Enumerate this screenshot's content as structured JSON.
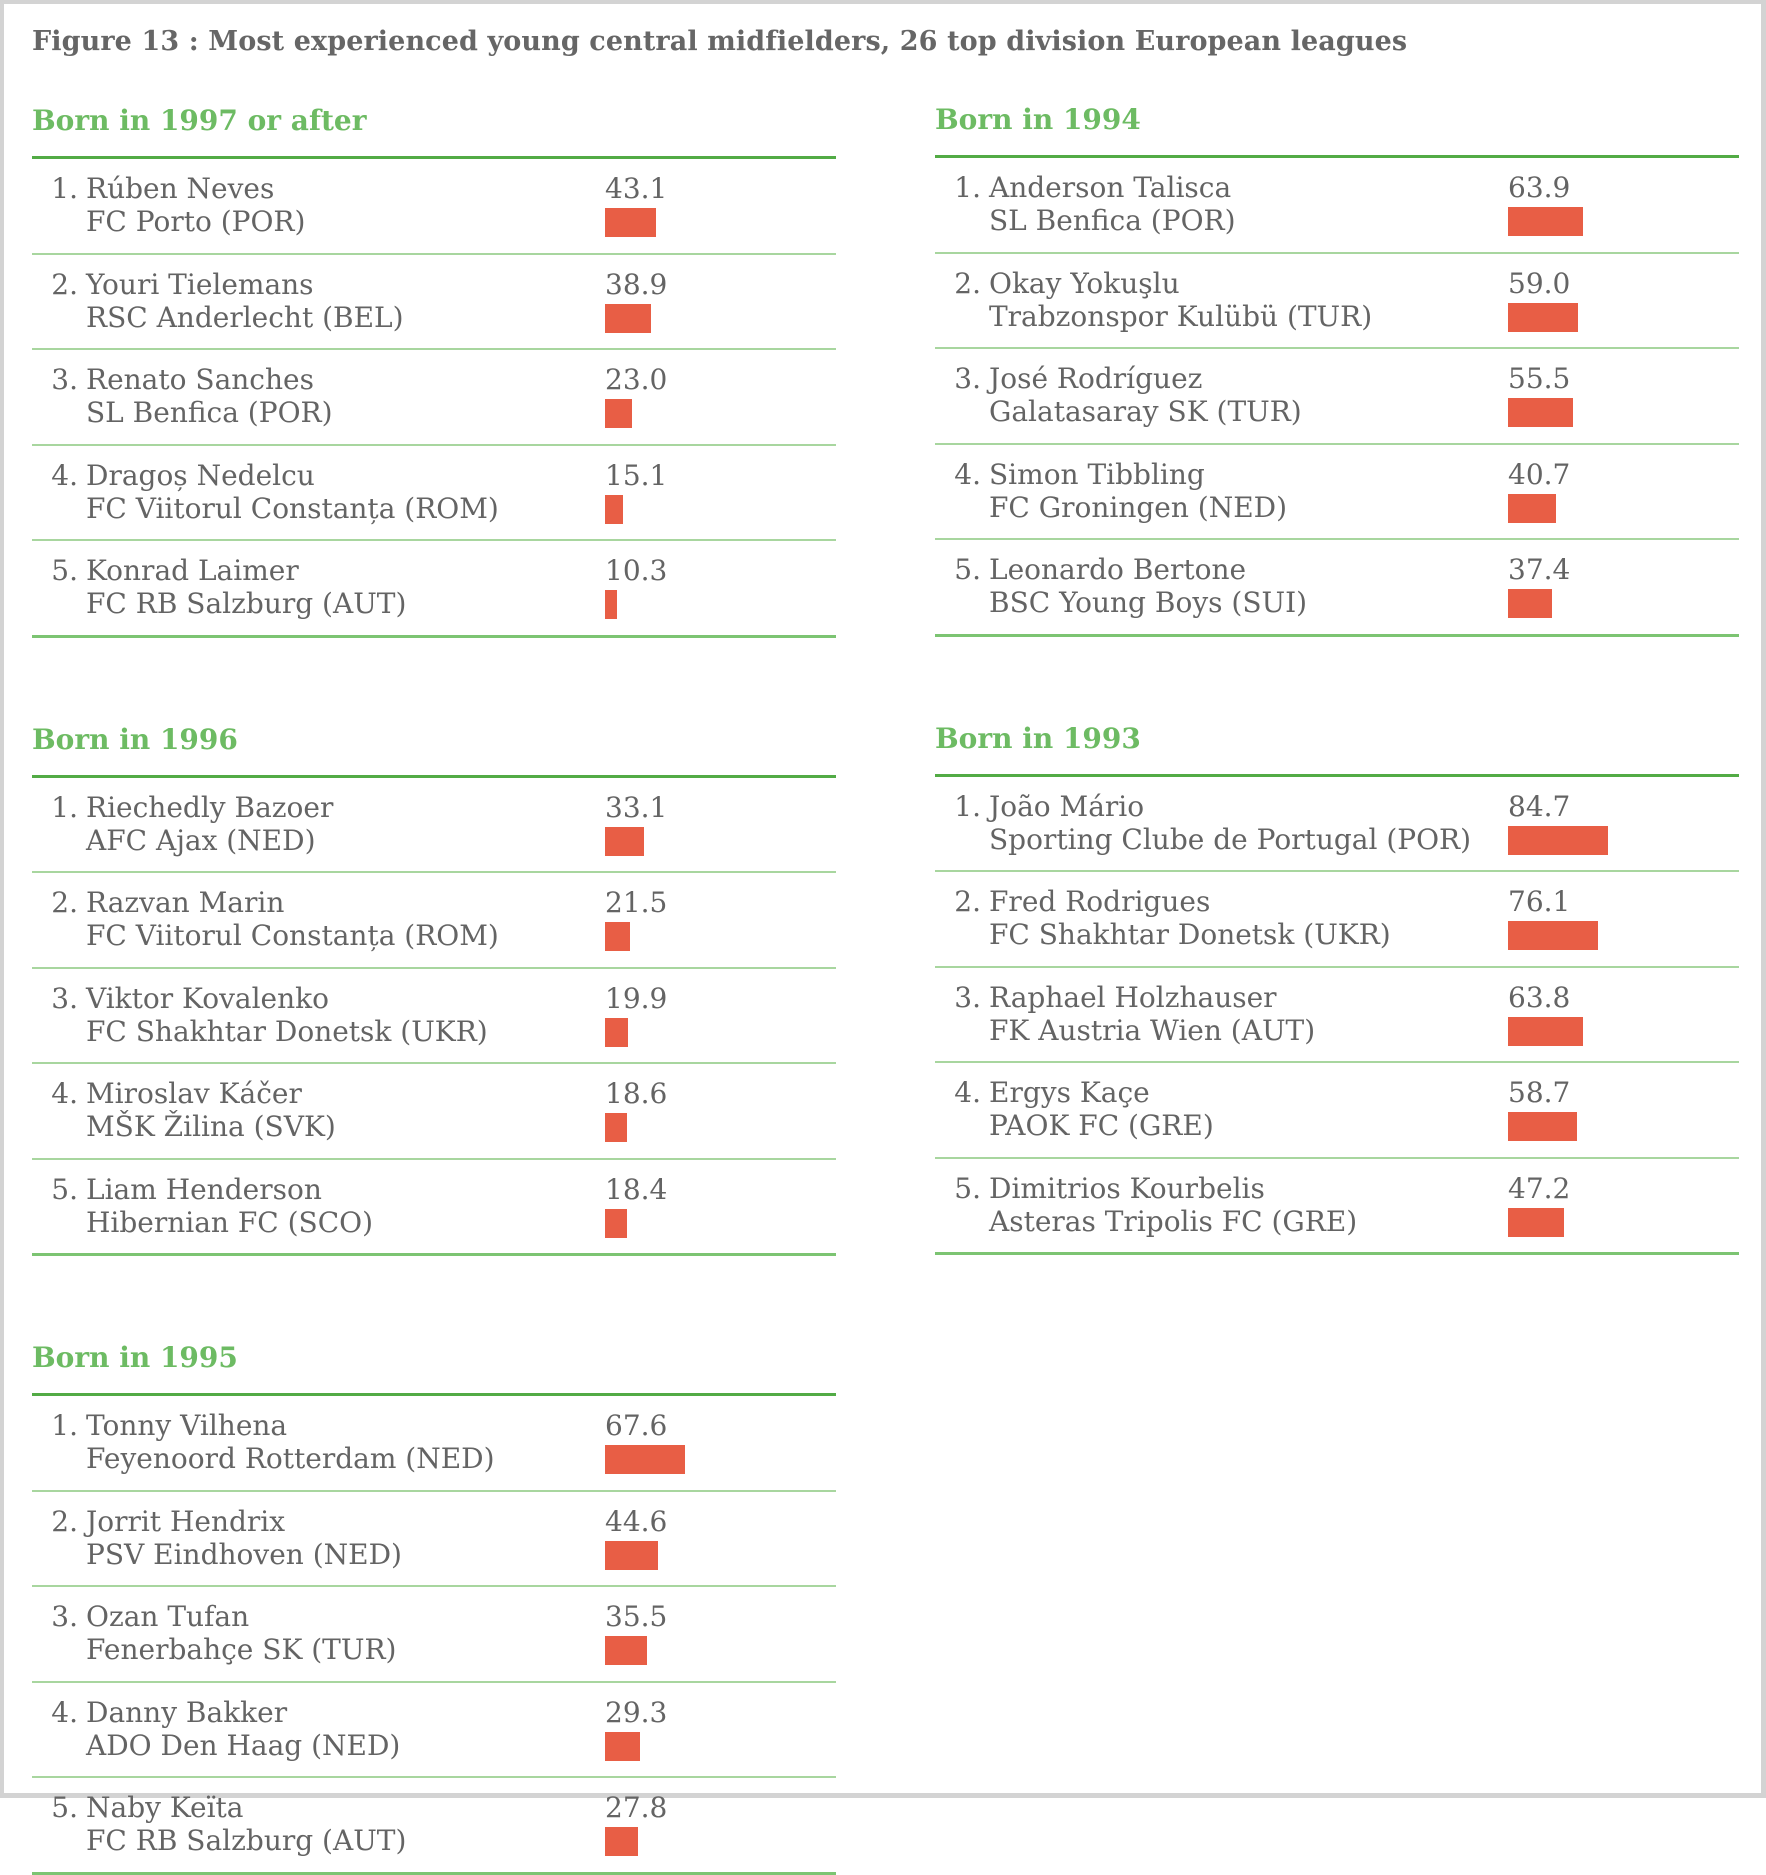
{
  "title": "Figure 13  : Most experienced young central midfielders, 26 top division European leagues",
  "colors": {
    "heading": "#6dbb63",
    "bar": "#e85e45",
    "text": "#646464",
    "rule": "#52ab45",
    "separator": "#a8d69f"
  },
  "chart_data": {
    "type": "bar",
    "title": "Figure 13  : Most experienced young central midfielders, 26 top division European leagues",
    "xlabel": "",
    "ylabel": "",
    "xlim": [
      0,
      100
    ],
    "grid": false,
    "groups": [
      {
        "heading": "Born in 1997 or after",
        "column": "left",
        "entries": [
          {
            "rank": "1.",
            "player": "Rúben Neves",
            "club": "FC Porto (POR)",
            "value": 43.1,
            "label": "43.1"
          },
          {
            "rank": "2.",
            "player": "Youri Tielemans",
            "club": "RSC Anderlecht (BEL)",
            "value": 38.9,
            "label": "38.9"
          },
          {
            "rank": "3.",
            "player": "Renato Sanches",
            "club": "SL Benfica (POR)",
            "value": 23.0,
            "label": "23.0"
          },
          {
            "rank": "4.",
            "player": "Dragoș Nedelcu",
            "club": "FC Viitorul Constanța (ROM)",
            "value": 15.1,
            "label": "15.1"
          },
          {
            "rank": "5.",
            "player": "Konrad Laimer",
            "club": "FC RB Salzburg (AUT)",
            "value": 10.3,
            "label": "10.3"
          }
        ]
      },
      {
        "heading": "Born in 1996",
        "column": "left",
        "entries": [
          {
            "rank": "1.",
            "player": "Riechedly Bazoer",
            "club": "AFC Ajax (NED)",
            "value": 33.1,
            "label": "33.1"
          },
          {
            "rank": "2.",
            "player": "Razvan Marin",
            "club": "FC Viitorul Constanța (ROM)",
            "value": 21.5,
            "label": "21.5"
          },
          {
            "rank": "3.",
            "player": "Viktor Kovalenko",
            "club": "FC Shakhtar Donetsk (UKR)",
            "value": 19.9,
            "label": "19.9"
          },
          {
            "rank": "4.",
            "player": "Miroslav Káčer",
            "club": "MŠK Žilina (SVK)",
            "value": 18.6,
            "label": "18.6"
          },
          {
            "rank": "5.",
            "player": "Liam Henderson",
            "club": "Hibernian FC (SCO)",
            "value": 18.4,
            "label": "18.4"
          }
        ]
      },
      {
        "heading": "Born in 1995",
        "column": "left",
        "entries": [
          {
            "rank": "1.",
            "player": "Tonny Vilhena",
            "club": "Feyenoord Rotterdam (NED)",
            "value": 67.6,
            "label": "67.6"
          },
          {
            "rank": "2.",
            "player": "Jorrit Hendrix",
            "club": "PSV Eindhoven (NED)",
            "value": 44.6,
            "label": "44.6"
          },
          {
            "rank": "3.",
            "player": "Ozan Tufan",
            "club": "Fenerbahçe SK (TUR)",
            "value": 35.5,
            "label": "35.5"
          },
          {
            "rank": "4.",
            "player": "Danny Bakker",
            "club": "ADO Den Haag (NED)",
            "value": 29.3,
            "label": "29.3"
          },
          {
            "rank": "5.",
            "player": "Naby Keïta",
            "club": "FC RB Salzburg (AUT)",
            "value": 27.8,
            "label": "27.8"
          }
        ]
      },
      {
        "heading": "Born in 1994",
        "column": "right",
        "entries": [
          {
            "rank": "1.",
            "player": "Anderson Talisca",
            "club": "SL Benfica (POR)",
            "value": 63.9,
            "label": "63.9"
          },
          {
            "rank": "2.",
            "player": "Okay Yokuşlu",
            "club": "Trabzonspor Kulübü (TUR)",
            "value": 59.0,
            "label": "59.0"
          },
          {
            "rank": "3.",
            "player": "José Rodríguez",
            "club": "Galatasaray SK (TUR)",
            "value": 55.5,
            "label": "55.5"
          },
          {
            "rank": "4.",
            "player": "Simon Tibbling",
            "club": "FC Groningen (NED)",
            "value": 40.7,
            "label": "40.7"
          },
          {
            "rank": "5.",
            "player": "Leonardo Bertone",
            "club": "BSC Young Boys (SUI)",
            "value": 37.4,
            "label": "37.4"
          }
        ]
      },
      {
        "heading": "Born in 1993",
        "column": "right",
        "entries": [
          {
            "rank": "1.",
            "player": "João Mário",
            "club": "Sporting Clube de Portugal (POR)",
            "value": 84.7,
            "label": "84.7"
          },
          {
            "rank": "2.",
            "player": "Fred Rodrigues",
            "club": "FC Shakhtar Donetsk (UKR)",
            "value": 76.1,
            "label": "76.1"
          },
          {
            "rank": "3.",
            "player": "Raphael Holzhauser",
            "club": "FK Austria Wien (AUT)",
            "value": 63.8,
            "label": "63.8"
          },
          {
            "rank": "4.",
            "player": "Ergys Kaçe",
            "club": "PAOK FC (GRE)",
            "value": 58.7,
            "label": "58.7"
          },
          {
            "rank": "5.",
            "player": "Dimitrios Kourbelis",
            "club": "Asteras Tripolis FC (GRE)",
            "value": 47.2,
            "label": "47.2"
          }
        ]
      }
    ]
  }
}
